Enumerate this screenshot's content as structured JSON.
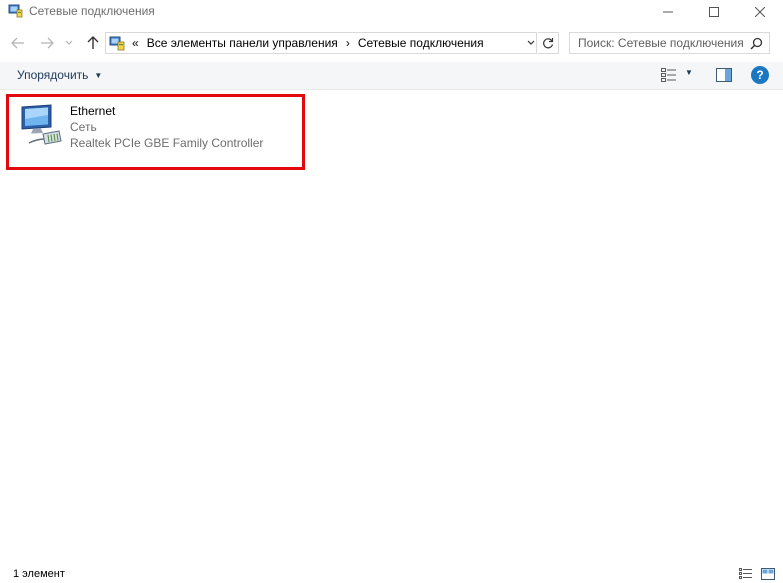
{
  "window": {
    "title": "Сетевые подключения"
  },
  "address_bar": {
    "overflow": "«",
    "crumbs": [
      "Все элементы панели управления",
      "Сетевые подключения"
    ],
    "separator": "›"
  },
  "search": {
    "placeholder": "Поиск: Сетевые подключения"
  },
  "commandbar": {
    "organize_label": "Упорядочить",
    "help_label": "?"
  },
  "items": [
    {
      "name": "Ethernet",
      "status": "Сеть",
      "device": "Realtek PCIe GBE Family Controller",
      "highlight_color": "#e3080e"
    }
  ],
  "statusbar": {
    "count": "1 элемент"
  },
  "icons": {
    "app": "network-connections-icon",
    "back": "arrow-left-icon",
    "forward": "arrow-right-icon",
    "recent": "chevron-down-icon",
    "up": "arrow-up-icon",
    "refresh": "refresh-icon",
    "search": "search-icon",
    "view": "change-view-icon",
    "pane": "preview-pane-icon",
    "help": "help-icon",
    "network_adapter": "network-adapter-icon"
  },
  "colors": {
    "accent": "#1a78c2",
    "command_text": "#1e395b",
    "highlight": "#e3080e"
  }
}
